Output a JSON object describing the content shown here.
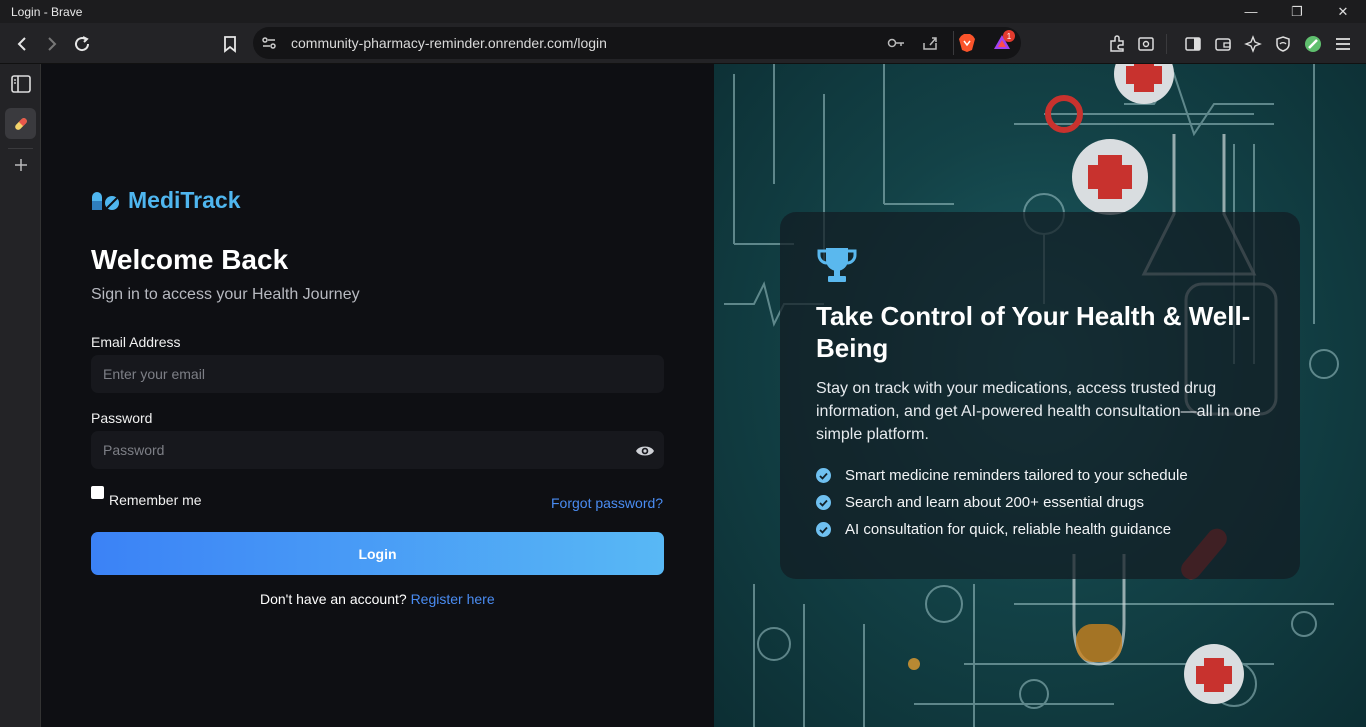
{
  "window": {
    "title": "Login - Brave",
    "controls": [
      "minimize-icon",
      "restore-icon",
      "close-icon"
    ]
  },
  "browser": {
    "url": "community-pharmacy-reminder.onrender.com/login",
    "rewards_badge": "1"
  },
  "app": {
    "brand": "MediTrack",
    "heading": "Welcome Back",
    "subtitle": "Sign in to access your Health Journey",
    "email_label": "Email Address",
    "email_placeholder": "Enter your email",
    "password_label": "Password",
    "password_placeholder": "Password",
    "remember_label": "Remember me",
    "forgot_link": "Forgot password?",
    "login_button": "Login",
    "register_prompt": "Don't have an account?",
    "register_link": "Register here"
  },
  "promo": {
    "title": "Take Control of Your Health & Well-Being",
    "description": "Stay on track with your medications, access trusted drug information, and get AI-powered health consultation—all in one simple platform.",
    "features": [
      "Smart medicine reminders tailored to your schedule",
      "Search and learn about 200+ essential drugs",
      "AI consultation for quick, reliable health guidance"
    ]
  },
  "colors": {
    "accent": "#4fb6ef",
    "link": "#4a8cf2",
    "button_gradient_start": "#3b82f6",
    "button_gradient_end": "#58b8f5"
  }
}
